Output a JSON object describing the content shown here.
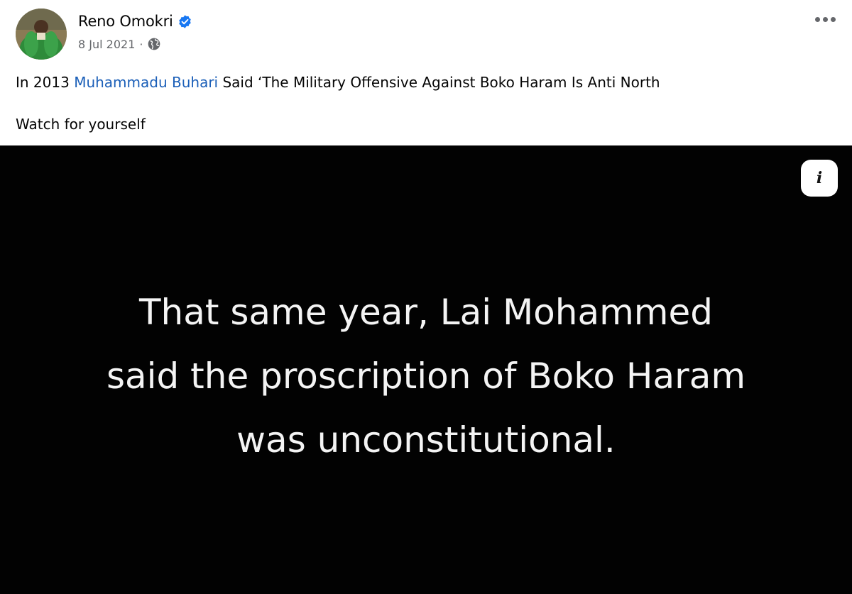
{
  "post": {
    "author": "Reno Omokri",
    "verified_icon": "verified-badge-icon",
    "date": "8 Jul 2021",
    "separator": "·",
    "audience_icon": "globe-icon",
    "more_icon": "more-options-icon",
    "caption": {
      "prefix": "In 2013 ",
      "link": "Muhammadu Buhari",
      "suffix": " Said ‘The Military Offensive Against Boko Haram Is Anti North"
    },
    "caption2": "Watch for yourself"
  },
  "media": {
    "lines": [
      "That same year, Lai Mohammed",
      "said the proscription of Boko Haram",
      "was unconstitutional."
    ],
    "info_label": "i",
    "info_icon": "info-icon"
  },
  "colors": {
    "link": "#1b5fb8",
    "verified": "#1877f2",
    "media_bg": "#020202",
    "media_text": "#f4f4f4"
  }
}
